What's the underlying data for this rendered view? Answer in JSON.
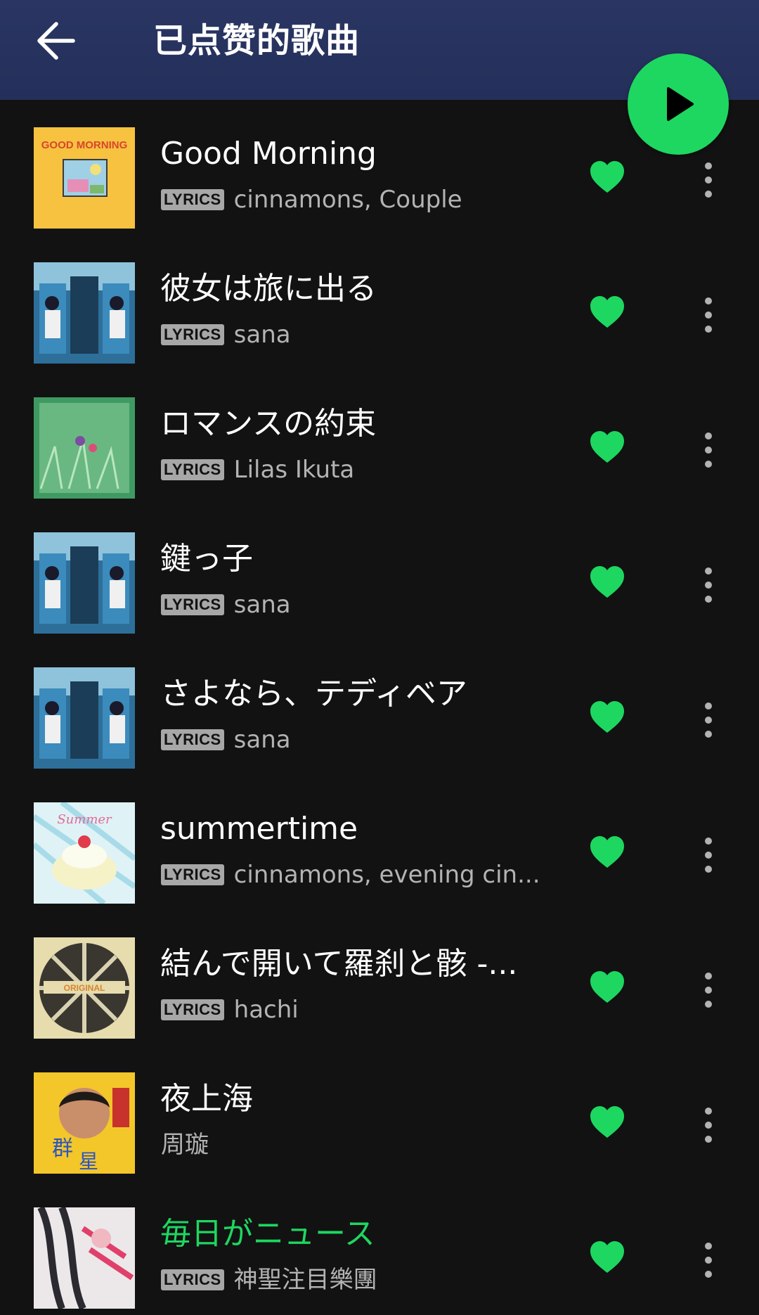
{
  "header": {
    "title": "已点赞的歌曲",
    "back_icon": "arrow-left-icon"
  },
  "colors": {
    "accent": "#1ed760",
    "header_bg": "#2a3563",
    "background": "#121212",
    "secondary_text": "#b3b3b3",
    "badge_bg": "#a7a7a7"
  },
  "play_button": {
    "icon": "play-icon"
  },
  "songs": [
    {
      "title": "Good Morning",
      "lyrics_badge": "LYRICS",
      "artist": "cinnamons, Couple",
      "liked": true,
      "playing": false
    },
    {
      "title": "彼女は旅に出る",
      "lyrics_badge": "LYRICS",
      "artist": "sana",
      "liked": true,
      "playing": false
    },
    {
      "title": "ロマンスの約束",
      "lyrics_badge": "LYRICS",
      "artist": "Lilas Ikuta",
      "liked": true,
      "playing": false
    },
    {
      "title": "鍵っ子",
      "lyrics_badge": "LYRICS",
      "artist": "sana",
      "liked": true,
      "playing": false
    },
    {
      "title": "さよなら、テディベア",
      "lyrics_badge": "LYRICS",
      "artist": "sana",
      "liked": true,
      "playing": false
    },
    {
      "title": "summertime",
      "lyrics_badge": "LYRICS",
      "artist": "cinnamons, evening cin...",
      "liked": true,
      "playing": false
    },
    {
      "title": "結んで開いて羅刹と骸 -...",
      "lyrics_badge": "LYRICS",
      "artist": "hachi",
      "liked": true,
      "playing": false
    },
    {
      "title": "夜上海",
      "lyrics_badge": "",
      "artist": "周璇",
      "liked": true,
      "playing": false
    },
    {
      "title": "毎日がニュース",
      "lyrics_badge": "LYRICS",
      "artist": "神聖注目樂團",
      "liked": true,
      "playing": true
    }
  ]
}
